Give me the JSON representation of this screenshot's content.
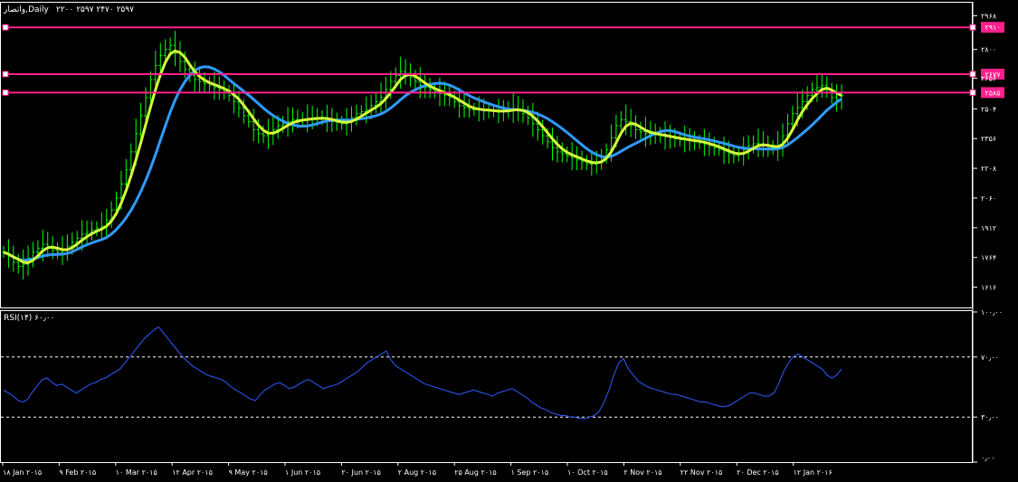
{
  "header": {
    "symbol_title": "واتصار,Daily",
    "ohlc_text": "۲۲۰۰ ۲۵۹۷ ۲۴۷۰ ۲۵۹۷"
  },
  "rsi_header": {
    "title": "RSI(۱۴) ۶۰٫۰۰"
  },
  "colors": {
    "background": "#000000",
    "grid_frame": "#ffffff",
    "candle": "#00ff00",
    "ma_fast": "#d4ff3c",
    "ma_slow": "#2f9bff",
    "hline": "#ff1f8c",
    "rsi_line": "#2f5bff"
  },
  "chart_data": [
    {
      "type": "line",
      "title": "واتصار,Daily",
      "price_axis_ticks": [
        "۲۹۶۸",
        "۲۸۰۰",
        "۲۶۵۶",
        "۲۵۰۴",
        "۲۳۵۶",
        "۲۲۰۸",
        "۲۰۶۰",
        "۱۹۱۲",
        "۱۷۶۴",
        "۱۶۱۶"
      ],
      "price_tick_values": [
        2968,
        2800,
        2656,
        2504,
        2356,
        2208,
        2060,
        1912,
        1764,
        1616
      ],
      "ylim": [
        1560,
        3010
      ],
      "horizontal_levels": [
        {
          "label": "۲۹۱۰",
          "value": 2910
        },
        {
          "label": "۲۶۷۷",
          "value": 2677
        },
        {
          "label": "۲۵۸۵",
          "value": 2585
        }
      ],
      "x_ticks": [
        "۱۸ Jan ۲۰۱۵",
        "۹ Feb ۲۰۱۵",
        "۱۰ Mar ۲۰۱۵",
        "۱۲ Apr ۲۰۱۵",
        "۹ May ۲۰۱۵",
        "۱ Jun ۲۰۱۵",
        "۲۰ Jun ۲۰۱۵",
        "۲ Aug ۲۰۱۵",
        "۲۵ Aug ۲۰۱۵",
        "۱ Sep ۲۰۱۵",
        "۱۰ Oct ۲۰۱۵",
        "۲ Nov ۲۰۱۵",
        "۲۲ Nov ۲۰۱۵",
        "۲۰ Dec ۲۰۱۵",
        "۱۲ Jan ۲۰۱۶"
      ],
      "series_close": [
        1790,
        1770,
        1740,
        1720,
        1730,
        1760,
        1790,
        1810,
        1830,
        1820,
        1800,
        1790,
        1800,
        1820,
        1840,
        1860,
        1880,
        1890,
        1900,
        1910,
        1920,
        1950,
        2000,
        2060,
        2130,
        2200,
        2290,
        2380,
        2470,
        2560,
        2650,
        2720,
        2770,
        2800,
        2820,
        2780,
        2740,
        2700,
        2670,
        2650,
        2640,
        2630,
        2620,
        2610,
        2600,
        2590,
        2570,
        2540,
        2510,
        2470,
        2440,
        2400,
        2380,
        2370,
        2380,
        2400,
        2420,
        2430,
        2440,
        2450,
        2450,
        2450,
        2455,
        2460,
        2460,
        2455,
        2450,
        2440,
        2435,
        2430,
        2440,
        2460,
        2480,
        2490,
        2500,
        2520,
        2540,
        2560,
        2600,
        2640,
        2670,
        2690,
        2680,
        2660,
        2640,
        2620,
        2610,
        2600,
        2590,
        2580,
        2570,
        2560,
        2540,
        2520,
        2510,
        2500,
        2500,
        2500,
        2495,
        2495,
        2490,
        2490,
        2495,
        2500,
        2505,
        2500,
        2480,
        2460,
        2430,
        2400,
        2370,
        2340,
        2310,
        2290,
        2280,
        2270,
        2260,
        2250,
        2240,
        2230,
        2230,
        2240,
        2260,
        2300,
        2360,
        2420,
        2450,
        2440,
        2420,
        2400,
        2390,
        2380,
        2380,
        2375,
        2370,
        2365,
        2360,
        2355,
        2350,
        2350,
        2345,
        2340,
        2335,
        2330,
        2320,
        2310,
        2300,
        2290,
        2280,
        2270,
        2280,
        2300,
        2320,
        2330,
        2330,
        2320,
        2310,
        2310,
        2320,
        2370,
        2430,
        2480,
        2510,
        2540,
        2570,
        2600,
        2610,
        2620,
        2600,
        2560,
        2550,
        2570
      ],
      "series": [
        {
          "name": "MA fast",
          "color": "#d4ff3c"
        },
        {
          "name": "MA slow",
          "color": "#2f9bff"
        }
      ]
    },
    {
      "type": "line",
      "title": "RSI(۱۴) ۶۰٫۰۰",
      "levels": [
        {
          "label": "۱۰۰٫۰۰",
          "value": 100
        },
        {
          "label": "۷۰٫۰۰",
          "value": 70
        },
        {
          "label": "۳۰٫۰۰",
          "value": 30
        },
        {
          "label": "۰٫۰۰",
          "value": 0
        }
      ],
      "ylim": [
        0,
        100
      ],
      "values": [
        48,
        46,
        44,
        41,
        40,
        42,
        47,
        51,
        55,
        56,
        53,
        51,
        52,
        50,
        48,
        46,
        48,
        50,
        52,
        53,
        55,
        56,
        58,
        60,
        62,
        66,
        70,
        74,
        78,
        82,
        85,
        88,
        90,
        86,
        82,
        78,
        74,
        70,
        67,
        64,
        62,
        60,
        58,
        57,
        56,
        55,
        53,
        50,
        48,
        46,
        44,
        42,
        41,
        45,
        48,
        50,
        52,
        53,
        51,
        49,
        50,
        52,
        54,
        55,
        53,
        51,
        49,
        50,
        51,
        52,
        54,
        56,
        58,
        60,
        63,
        66,
        68,
        70,
        72,
        74,
        68,
        64,
        62,
        60,
        58,
        56,
        54,
        52,
        51,
        50,
        49,
        48,
        47,
        46,
        45,
        46,
        47,
        48,
        47,
        46,
        45,
        44,
        46,
        47,
        48,
        49,
        47,
        45,
        43,
        40,
        38,
        36,
        35,
        33,
        32,
        31,
        31,
        30,
        30,
        29,
        29,
        30,
        31,
        34,
        40,
        48,
        58,
        66,
        69,
        62,
        58,
        54,
        52,
        50,
        49,
        48,
        47,
        46,
        45,
        45,
        44,
        43,
        42,
        41,
        40,
        40,
        39,
        38,
        37,
        37,
        38,
        40,
        42,
        44,
        46,
        46,
        45,
        44,
        44,
        46,
        52,
        60,
        66,
        70,
        72,
        70,
        68,
        66,
        64,
        62,
        58,
        56,
        58,
        62
      ]
    }
  ]
}
